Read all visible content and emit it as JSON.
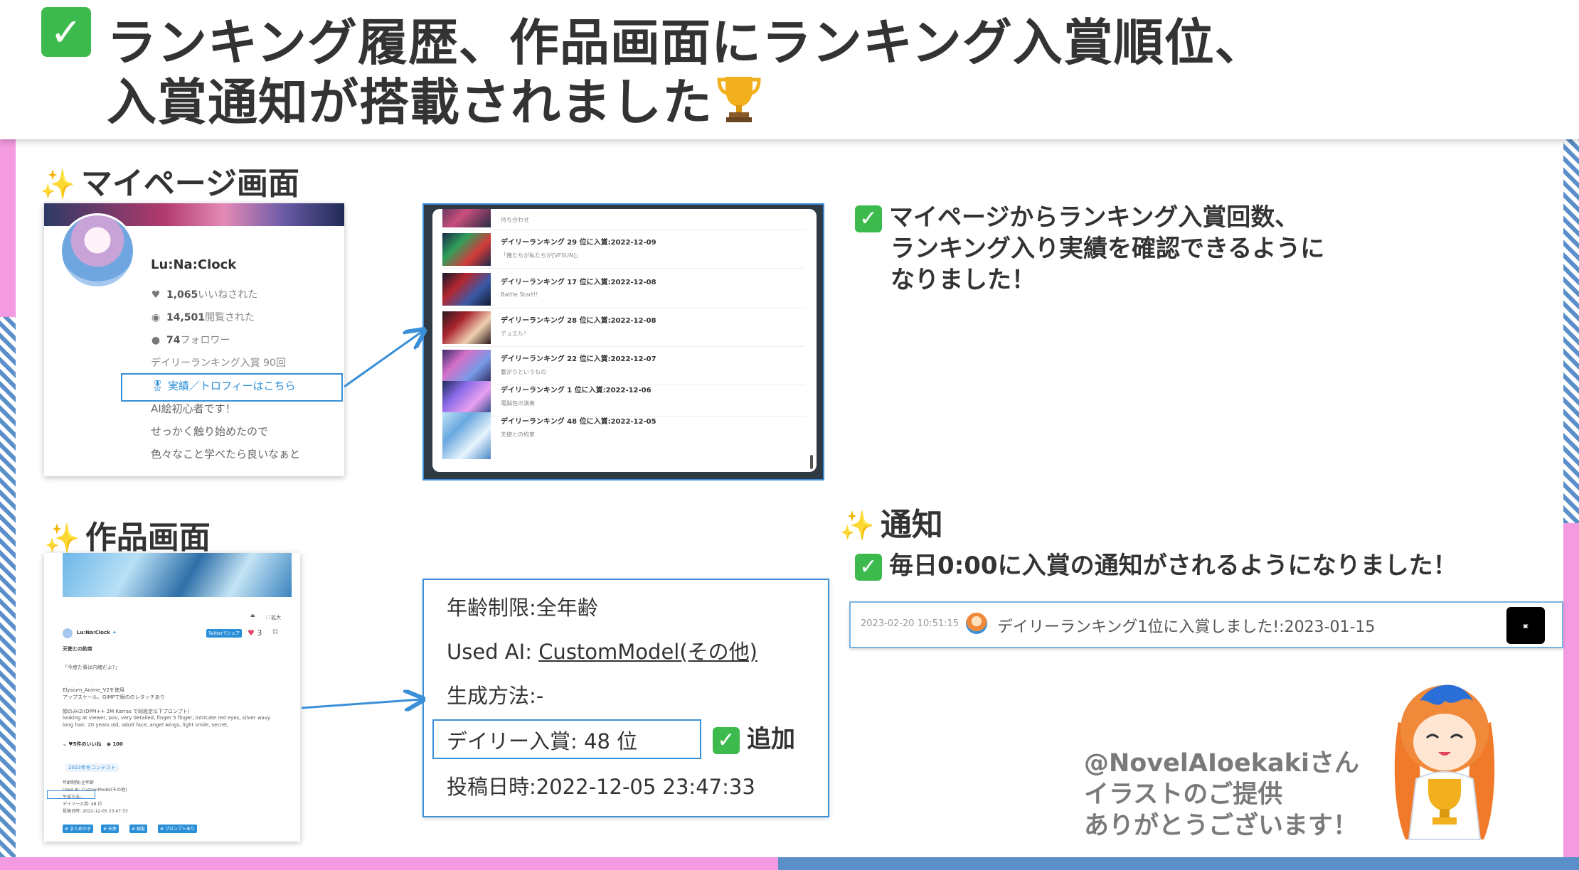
{
  "title": {
    "line1": "ランキング履歴、作品画面にランキング入賞順位、",
    "line2": "入賞通知が搭載されました"
  },
  "mypage": {
    "heading": "マイページ画面",
    "profile": {
      "name": "Lu:Na:Clock",
      "likes_count": "1,065",
      "likes_label": "いいねされた",
      "views_count": "14,501",
      "views_label": "閲覧された",
      "followers_count": "74",
      "followers_label": "フォロワー",
      "ranking_entries": "デイリーランキング入賞 90回",
      "trophy_link": "実績／トロフィーはこちら",
      "bio_lines": [
        "AI絵初心者です！",
        "せっかく触り始めたので",
        "色々なこと学べたら良いなぁと"
      ]
    },
    "history": [
      {
        "title": "デイリーランキング 29 位に入賞:2022-12-09",
        "work": "「俺たちが私たちが[VFSUN]」"
      },
      {
        "title": "デイリーランキング 17 位に入賞:2022-12-08",
        "work": "Battle Start!!"
      },
      {
        "title": "デイリーランキング 28 位に入賞:2022-12-08",
        "work": "デュエル！"
      },
      {
        "title": "デイリーランキング 22 位に入賞:2022-12-07",
        "work": "繋がりというもの"
      },
      {
        "title": "デイリーランキング 1 位に入賞:2022-12-06",
        "work": "電脳色の演奏"
      },
      {
        "title": "デイリーランキング 48 位に入賞:2022-12-05",
        "work": "天使との約束"
      }
    ],
    "history_top_partial": "待ち合わせ",
    "bullet_lines": [
      "マイページからランキング入賞回数、",
      "ランキング入り実績を確認できるように",
      "なりました！"
    ]
  },
  "artwork": {
    "heading": "作品画面",
    "author": "Lu:Na:Clock",
    "share_label": "Twitterでシェア",
    "likes": "3",
    "expand_label": "拡大",
    "work_title": "天使との約束",
    "quote": "「今度た事は内緒だよ?」",
    "desc_lines": [
      "Elysium_Anime_V2を使用",
      "アップスケール、GIMPで眼ののレタッチあり",
      "顔のみi2i(DPM++ 2M Karras で同設定以下プロンプト)",
      "looking at viewer, pov, very detailed, finger 5 finger, intricate red eyes, silver wavy",
      "long hair, 20 years old, adult face, angel wings, light smile, secret,"
    ],
    "like_summary": "5件のいいね",
    "view_summary": "100",
    "contest_tag": "2023年冬コンテスト",
    "meta_lines": [
      "年齢制限:全年齢",
      "Used AI: CustomModel(その他)",
      "生成方法:-",
      "デイリー入賞: 48 位",
      "投稿日時: 2022-12-05 23:47:33"
    ],
    "tags": [
      "# まとめの子",
      "# 天使",
      "# 銀髪",
      "# プロンプトあり"
    ]
  },
  "info": {
    "age": "年齢制限:全年齢",
    "used_ai_label": "Used AI:",
    "used_ai_value": "CustomModel(その他)",
    "method": "生成方法:-",
    "rank": "デイリー入賞: 48 位",
    "posted": "投稿日時:2022-12-05 23:47:33",
    "add_label": "追加"
  },
  "notification": {
    "heading": "通知",
    "bullet": "毎日0:00に入賞の通知がされるようになりました！",
    "time": "2023-02-20 10:51:15",
    "message": "デイリーランキング1位に入賞しました!:2023-01-15"
  },
  "credit": {
    "lines": [
      "@NovelAIoekakiさん",
      "イラストのご提供",
      "ありがとうございます！"
    ]
  },
  "colors": {
    "accent_blue": "#3a8fd8",
    "check_green": "#3dba4e",
    "frame_pink": "#f49ae0",
    "frame_blue": "#5b8fc9"
  },
  "icons": {
    "check": "white-check-mark",
    "sparkle": "sparkles",
    "trophy": "trophy"
  }
}
